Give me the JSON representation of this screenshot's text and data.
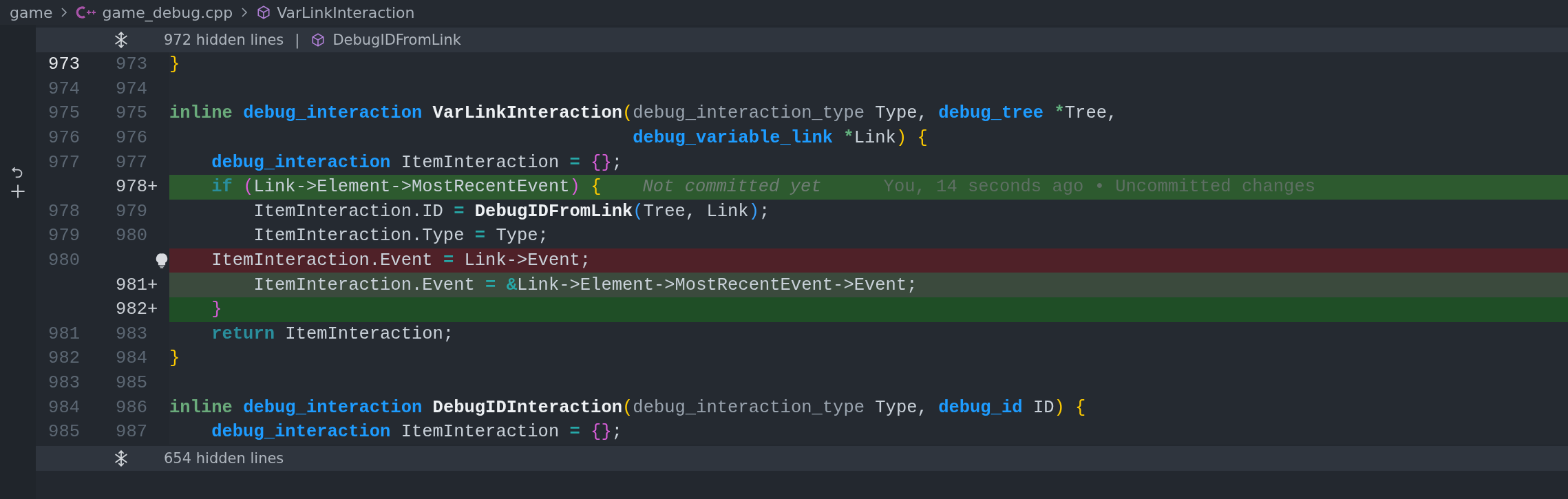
{
  "breadcrumbs": [
    {
      "kind": "folder",
      "label": "game"
    },
    {
      "kind": "cpp",
      "label": "game_debug.cpp"
    },
    {
      "kind": "symbol",
      "label": "VarLinkInteraction"
    }
  ],
  "hidden_top": {
    "label": "972 hidden lines",
    "separator": "|",
    "symbol": "DebugIDFromLink"
  },
  "lines": [
    {
      "kind": "context",
      "current": true,
      "old": "973",
      "new": "973",
      "tokens": [
        {
          "kind": "by",
          "t": "}"
        }
      ]
    },
    {
      "kind": "context",
      "current": false,
      "old": "974",
      "new": "974"
    },
    {
      "kind": "context",
      "current": false,
      "old": "975",
      "new": "975",
      "tokens": [
        {
          "kind": "kw",
          "t": "inline "
        },
        {
          "kind": "type",
          "t": "debug_interaction "
        },
        {
          "kind": "fn",
          "t": "VarLinkInteraction"
        },
        {
          "kind": "by",
          "t": "("
        },
        {
          "kind": "dim",
          "t": "debug_interaction_type "
        },
        {
          "kind": "txt",
          "t": "Type, "
        },
        {
          "kind": "type",
          "t": "debug_tree "
        },
        {
          "kind": "ptr",
          "t": "*"
        },
        {
          "kind": "txt",
          "t": "Tree,"
        }
      ]
    },
    {
      "kind": "context",
      "current": false,
      "old": "976",
      "new": "976",
      "tokens": [
        {
          "kind": "type",
          "t": "                                            debug_variable_link "
        },
        {
          "kind": "ptr",
          "t": "*"
        },
        {
          "kind": "txt",
          "t": "Link"
        },
        {
          "kind": "by",
          "t": ") {"
        }
      ]
    },
    {
      "kind": "context",
      "current": false,
      "old": "977",
      "new": "977",
      "tokens": [
        {
          "kind": "type",
          "t": "    debug_interaction "
        },
        {
          "kind": "txt",
          "t": "ItemInteraction "
        },
        {
          "kind": "op",
          "t": "= "
        },
        {
          "kind": "bp",
          "t": "{}"
        },
        {
          "kind": "txt",
          "t": ";"
        }
      ]
    },
    {
      "kind": "added",
      "new": "978",
      "sign": "+",
      "tokens": [
        {
          "kind": "ctl",
          "t": "    if "
        },
        {
          "kind": "bp",
          "t": "("
        },
        {
          "kind": "txt",
          "t": "Link->Element->MostRecentEvent"
        },
        {
          "kind": "bp",
          "t": ")"
        },
        {
          "kind": "by",
          "t": " {"
        }
      ],
      "blame": {
        "note": "Not committed yet",
        "detail": "You, 14 seconds ago • Uncommitted changes"
      }
    },
    {
      "kind": "context",
      "current": false,
      "old": "978",
      "new": "979",
      "tokens": [
        {
          "kind": "txt",
          "t": "        ItemInteraction.ID "
        },
        {
          "kind": "op",
          "t": "= "
        },
        {
          "kind": "fn",
          "t": "DebugIDFromLink"
        },
        {
          "kind": "bb",
          "t": "("
        },
        {
          "kind": "txt",
          "t": "Tree, Link"
        },
        {
          "kind": "bb",
          "t": ")"
        },
        {
          "kind": "txt",
          "t": ";"
        }
      ]
    },
    {
      "kind": "context",
      "current": false,
      "old": "979",
      "new": "980",
      "tokens": [
        {
          "kind": "txt",
          "t": "        ItemInteraction.Type "
        },
        {
          "kind": "op",
          "t": "="
        },
        {
          "kind": "txt",
          "t": " Type;"
        }
      ]
    },
    {
      "kind": "removed",
      "current": false,
      "old": "980",
      "tokens": [
        {
          "kind": "txt",
          "t": "    ItemInteraction.Event "
        },
        {
          "kind": "op",
          "t": "="
        },
        {
          "kind": "txt",
          "t": " Link->Event;"
        }
      ]
    },
    {
      "kind": "changed",
      "new": "981",
      "sign": "+",
      "tokens": [
        {
          "kind": "txt",
          "t": "        ItemInteraction.Event "
        },
        {
          "kind": "op",
          "t": "= &"
        },
        {
          "kind": "txt",
          "t": "Link->Element->MostRecentEvent->Event;"
        }
      ]
    },
    {
      "kind": "added2",
      "new": "982",
      "sign": "+",
      "tokens": [
        {
          "kind": "bp",
          "t": "    }"
        }
      ]
    },
    {
      "kind": "context",
      "current": false,
      "old": "981",
      "new": "983",
      "tokens": [
        {
          "kind": "ctl",
          "t": "    return "
        },
        {
          "kind": "txt",
          "t": "ItemInteraction;"
        }
      ]
    },
    {
      "kind": "context",
      "current": false,
      "old": "982",
      "new": "984",
      "tokens": [
        {
          "kind": "by",
          "t": "}"
        }
      ]
    },
    {
      "kind": "context",
      "current": false,
      "old": "983",
      "new": "985"
    },
    {
      "kind": "context",
      "current": false,
      "old": "984",
      "new": "986",
      "tokens": [
        {
          "kind": "kw",
          "t": "inline "
        },
        {
          "kind": "type",
          "t": "debug_interaction "
        },
        {
          "kind": "fn",
          "t": "DebugIDInteraction"
        },
        {
          "kind": "by",
          "t": "("
        },
        {
          "kind": "dim",
          "t": "debug_interaction_type "
        },
        {
          "kind": "txt",
          "t": "Type, "
        },
        {
          "kind": "type",
          "t": "debug_id "
        },
        {
          "kind": "txt",
          "t": "ID"
        },
        {
          "kind": "by",
          "t": ") {"
        }
      ]
    },
    {
      "kind": "context",
      "current": false,
      "old": "985",
      "new": "987",
      "tokens": [
        {
          "kind": "type",
          "t": "    debug_interaction "
        },
        {
          "kind": "txt",
          "t": "ItemInteraction "
        },
        {
          "kind": "op",
          "t": "= "
        },
        {
          "kind": "bp",
          "t": "{}"
        },
        {
          "kind": "txt",
          "t": ";"
        }
      ]
    }
  ],
  "hidden_bottom": {
    "label": "654 hidden lines"
  }
}
